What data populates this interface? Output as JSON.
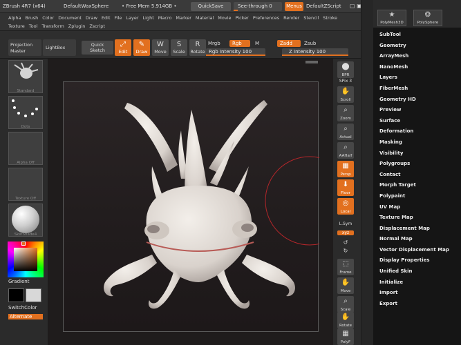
{
  "titlebar": {
    "app": "ZBrush 4R7 (x64)",
    "document": "DefaultWaxSphere",
    "mem": "• Free Mem 5.914GB •",
    "quicksave": "QuickSave",
    "see_through": "See-through  0",
    "menus": "Menus",
    "script": "DefaultZScript"
  },
  "menubar": {
    "row1": [
      "Alpha",
      "Brush",
      "Color",
      "Document",
      "Draw",
      "Edit",
      "File",
      "Layer",
      "Light",
      "Macro",
      "Marker",
      "Material",
      "Movie",
      "Picker",
      "Preferences",
      "Render",
      "Stencil",
      "Stroke"
    ],
    "row2": [
      "Texture",
      "Tool",
      "Transform",
      "Zplugin",
      "Zscript"
    ]
  },
  "toolbar": {
    "projection_master": "Projection Master",
    "lightbox": "LightBox",
    "quick_sketch": "Quick Sketch",
    "edit": "Edit",
    "draw": "Draw",
    "move": "Move",
    "scale": "Scale",
    "rotate": "Rotate",
    "mrgb": "Mrgb",
    "rgb": "Rgb",
    "m": "M",
    "rgb_intensity": "Rgb  Intensity 100",
    "zadd": "Zadd",
    "zsub": "Zsub",
    "z_intensity": "Z Intensity 100",
    "rgb_intensity_value": 100,
    "z_intensity_value": 100
  },
  "lefttray": {
    "brush_label": "Standard",
    "stroke_label": "Dots",
    "alpha_label": "Alpha Off",
    "texture_label": "Texture Off",
    "material_label": "SkinShade4",
    "gradient": "Gradient",
    "switch_color": "SwitchColor",
    "alternate": "Alternate"
  },
  "rightshelf": {
    "bpr": "BPR",
    "spix": "SPix 3",
    "scroll": "Scroll",
    "zoom": "Zoom",
    "actual": "Actual",
    "aahalf": "AAHalf",
    "persp": "Persp",
    "floor": "Floor",
    "local": "Local",
    "lsym": "L.Sym",
    "xyz": "xyz",
    "frame": "Frame",
    "move": "Move",
    "scale": "Scale",
    "rotate": "Rotate",
    "polyf": "PolyF"
  },
  "palette": {
    "thumb1": "PolyMesh3D",
    "thumb2": "PolySphere",
    "items": [
      "SubTool",
      "Geometry",
      "ArrayMesh",
      "NanoMesh",
      "Layers",
      "FiberMesh",
      "Geometry HD",
      "Preview",
      "Surface",
      "Deformation",
      "Masking",
      "Visibility",
      "Polygroups",
      "Contact",
      "Morph Target",
      "Polypaint",
      "UV Map",
      "Texture Map",
      "Displacement Map",
      "Normal Map",
      "Vector Displacement Map",
      "Display Properties",
      "Unified Skin",
      "Initialize",
      "Import",
      "Export"
    ]
  },
  "colors": {
    "accent": "#e2701f",
    "model": "#e7e1dc",
    "canvas": "#231e1f",
    "cursor": "#b3262a"
  }
}
